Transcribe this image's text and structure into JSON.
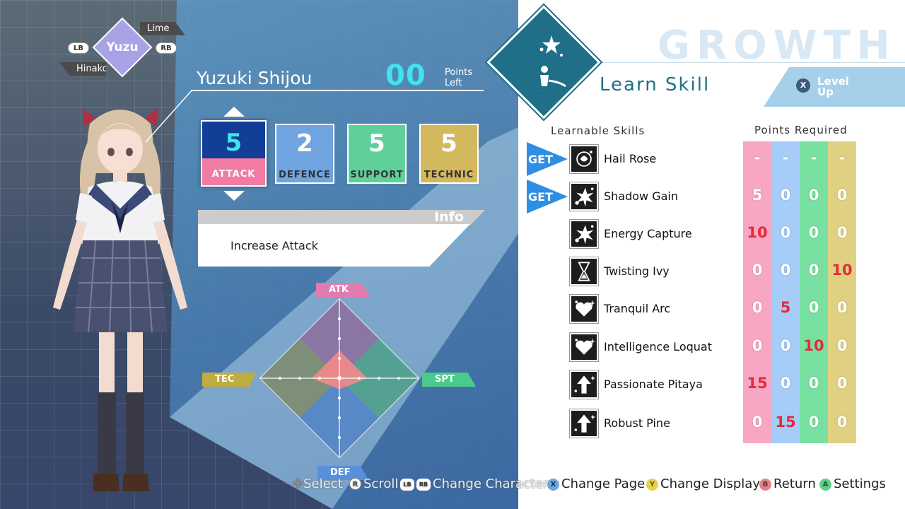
{
  "character": {
    "current": "Yuzu",
    "next": "Lime",
    "prev": "Hinako",
    "prev_button": "LB",
    "next_button": "RB",
    "full_name": "Yuzuki Shijou"
  },
  "points": {
    "value": "00",
    "label_line1": "Points",
    "label_line2": "Left"
  },
  "stats": [
    {
      "value": "5",
      "label": "ATTACK",
      "selected": true
    },
    {
      "value": "2",
      "label": "DEFENCE"
    },
    {
      "value": "5",
      "label": "SUPPORT"
    },
    {
      "value": "5",
      "label": "TECHNIC"
    }
  ],
  "info": {
    "title": "Info",
    "text": "Increase Attack"
  },
  "radar": {
    "labels": {
      "top": "ATK",
      "left": "TEC",
      "right": "SPT",
      "bottom": "DEF"
    },
    "axis_max": 5,
    "levels": {
      "atk": 5,
      "def": 2,
      "spt": 5,
      "tec": 5
    }
  },
  "panel": {
    "title": "GROWTH",
    "mode": "Learn Skill",
    "levelup_button": "X",
    "levelup_line1": "Level",
    "levelup_line2": "Up",
    "col_skills": "Learnable Skills",
    "col_points": "Points Required"
  },
  "skills": [
    {
      "name": "Hail Rose",
      "get": "GET",
      "icon": "rose-icon",
      "pts": [
        "-",
        "-",
        "-",
        "-"
      ],
      "hl": []
    },
    {
      "name": "Shadow Gain",
      "get": "GET",
      "icon": "burst-icon",
      "pts": [
        "5",
        "0",
        "0",
        "0"
      ],
      "hl": []
    },
    {
      "name": "Energy Capture",
      "get": "",
      "icon": "burst-icon",
      "pts": [
        "10",
        "0",
        "0",
        "0"
      ],
      "hl": [
        0
      ]
    },
    {
      "name": "Twisting Ivy",
      "get": "",
      "icon": "hourglass-icon",
      "pts": [
        "0",
        "0",
        "0",
        "10"
      ],
      "hl": [
        3
      ]
    },
    {
      "name": "Tranquil Arc",
      "get": "",
      "icon": "heart-sparkle-icon",
      "pts": [
        "0",
        "5",
        "0",
        "0"
      ],
      "hl": [
        1
      ]
    },
    {
      "name": "Intelligence Loquat",
      "get": "",
      "icon": "heart-sparkle-icon",
      "pts": [
        "0",
        "0",
        "10",
        "0"
      ],
      "hl": [
        2
      ]
    },
    {
      "name": "Passionate Pitaya",
      "get": "",
      "icon": "arrow-up-sparkle-icon",
      "pts": [
        "15",
        "0",
        "0",
        "0"
      ],
      "hl": [
        0
      ]
    },
    {
      "name": "Robust Pine",
      "get": "",
      "icon": "arrow-up-sparkle-icon",
      "pts": [
        "0",
        "15",
        "0",
        "0"
      ],
      "hl": [
        1
      ]
    }
  ],
  "hints": [
    {
      "button": "+",
      "label": "Select"
    },
    {
      "button": "R",
      "label": "Scroll"
    },
    {
      "button": "LB",
      "button2": "RB",
      "label": "Change Character"
    },
    {
      "button": "X",
      "label": "Change Page",
      "color": "#6aa7e0"
    },
    {
      "button": "Y",
      "label": "Change Display",
      "color": "#e8d24a"
    },
    {
      "button": "B",
      "label": "Return",
      "color": "#e8808a"
    },
    {
      "button": "A",
      "label": "Settings",
      "color": "#5ccf8a"
    }
  ],
  "colors": {
    "atk": "#f7a7c4",
    "def": "#a5cdf7",
    "spt": "#78e0a1",
    "tec": "#e0d081",
    "accent_teal": "#1f6f88",
    "points_cyan": "#41e3ec",
    "required_red": "#e62a3a"
  }
}
